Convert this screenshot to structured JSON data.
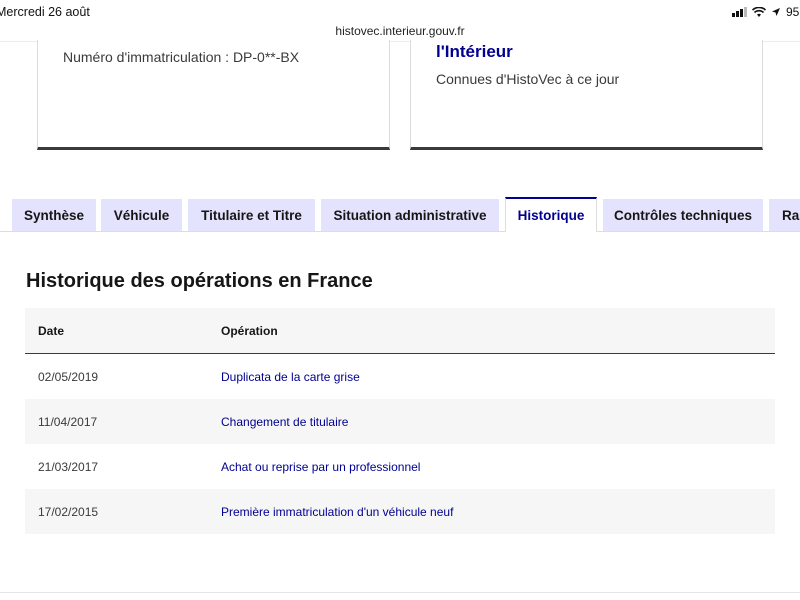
{
  "status_bar": {
    "time": "Mercredi 26 août",
    "battery": "95"
  },
  "browser": {
    "url": "histovec.interieur.gouv.fr"
  },
  "cards": {
    "left": {
      "registration": "Numéro d'immatriculation : DP-0**-BX"
    },
    "right": {
      "title": "l'Intérieur",
      "subtitle": "Connues d'HistoVec à ce jour"
    }
  },
  "tabs": [
    {
      "label": "Synthèse"
    },
    {
      "label": "Véhicule"
    },
    {
      "label": "Titulaire et Titre"
    },
    {
      "label": "Situation administrative"
    },
    {
      "label": "Historique"
    },
    {
      "label": "Contrôles techniques"
    },
    {
      "label": "Rap"
    }
  ],
  "active_tab": "Historique",
  "history": {
    "title": "Historique des opérations en France",
    "columns": {
      "date": "Date",
      "operation": "Opération"
    },
    "rows": [
      {
        "date": "02/05/2019",
        "operation": "Duplicata de la carte grise"
      },
      {
        "date": "11/04/2017",
        "operation": "Changement de titulaire"
      },
      {
        "date": "21/03/2017",
        "operation": "Achat ou reprise par un professionnel"
      },
      {
        "date": "17/02/2015",
        "operation": "Première immatriculation d'un véhicule neuf"
      }
    ]
  },
  "colors": {
    "accent_blue": "#000091",
    "tab_background": "#e3e3fd",
    "row_alt": "#f6f6f6"
  }
}
